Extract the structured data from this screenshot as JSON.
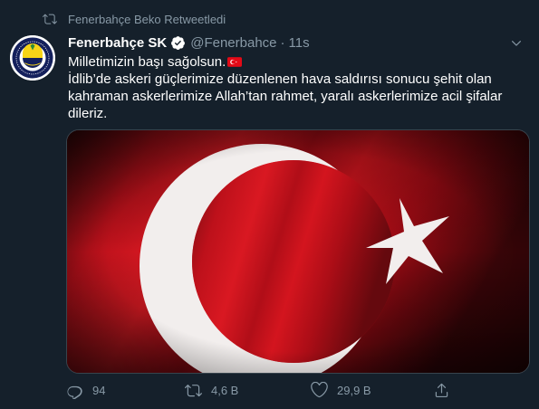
{
  "retweet_context": {
    "icon": "retweet-icon",
    "text": "Fenerbahçe Beko Retweetledi"
  },
  "author": {
    "name": "Fenerbahçe SK",
    "handle": "@Fenerbahce",
    "separator": "·",
    "time": "11s",
    "verified": true,
    "avatar_icon": "fenerbahce-crest-icon"
  },
  "tweet": {
    "line1": "Milletimizin başı sağolsun.",
    "line1_emoji": "turkish-flag-emoji",
    "line2": "İdlib’de askeri güçlerimize düzenlenen hava saldırısı sonucu şehit olan",
    "line3": "kahraman askerlerimize Allah’tan rahmet, yaralı askerlerimize acil şifalar",
    "line4": "dileriz."
  },
  "media": {
    "description_icon": "turkish-flag-image",
    "colors": {
      "red": "#c4111c",
      "white": "#f4f0ef"
    }
  },
  "actions": {
    "reply_count": "94",
    "retweet_count": "4,6 B",
    "like_count": "29,9 B",
    "share_icon": "share-icon"
  },
  "colors": {
    "background": "#15202b",
    "secondary_text": "#8899a6",
    "verified": "#1da1f2",
    "border": "#38444d"
  }
}
